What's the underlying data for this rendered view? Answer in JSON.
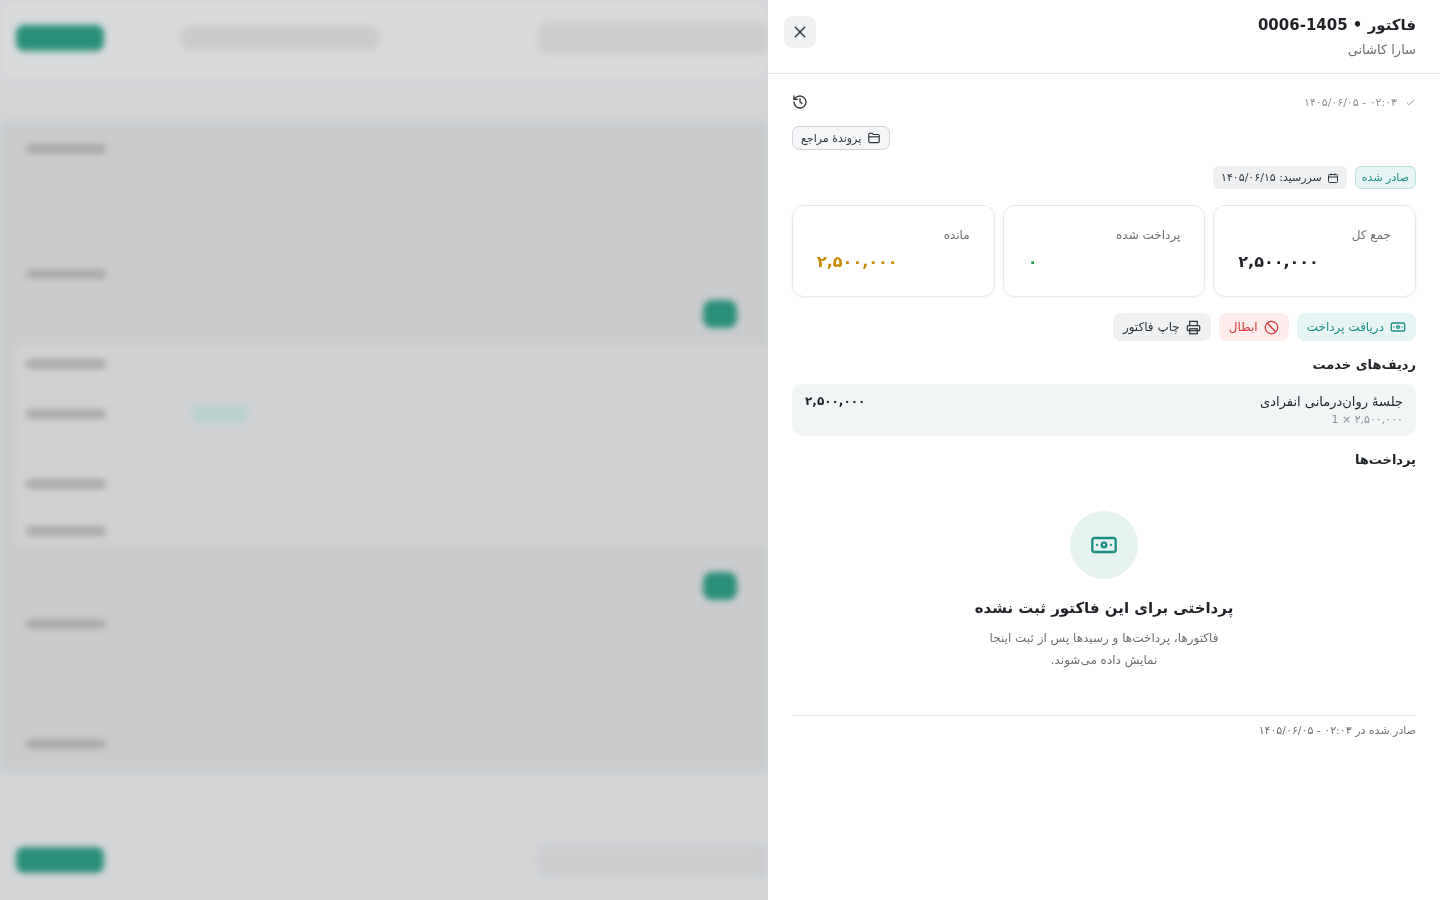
{
  "drawer": {
    "title": "فاکتور • 1405-0006",
    "subtitle": "سارا کاشانی",
    "issued_line": "۰۲:۰۳ - ۱۴۰۵/۰۶/۰۵",
    "client_file_button": "پروندهٔ مراجع",
    "status_badge": "صادر شده",
    "due_chip": "سررسید: ۱۴۰۵/۰۶/۱۵",
    "summary": [
      {
        "label": "جمع کل",
        "value": "۲,۵۰۰,۰۰۰",
        "color": "#1f2328"
      },
      {
        "label": "پرداخت شده",
        "value": "۰",
        "color": "#1f9d55"
      },
      {
        "label": "مانده",
        "value": "۲,۵۰۰,۰۰۰",
        "color": "#c98a06"
      }
    ],
    "actions": [
      {
        "kind": "receive",
        "label": "دریافت پرداخت"
      },
      {
        "kind": "cancel",
        "label": "ابطال"
      },
      {
        "kind": "print",
        "label": "چاپ فاکتور"
      }
    ],
    "services_title": "ردیف‌های خدمت",
    "services": [
      {
        "name": "جلسهٔ روان‌درمانی انفرادی",
        "detail": "۲,۵۰۰,۰۰۰ × 1",
        "amount": "۲,۵۰۰,۰۰۰"
      }
    ],
    "payments_title": "پرداخت‌ها",
    "empty_state": {
      "title": "پرداختی برای این فاکتور ثبت نشده",
      "text": "فاکتورها، پرداخت‌ها و رسیدها پس از ثبت اینجا نمایش داده می‌شوند."
    },
    "footer": "صادر شده در ۰۲:۰۳ - ۱۴۰۵/۰۶/۰۵"
  }
}
